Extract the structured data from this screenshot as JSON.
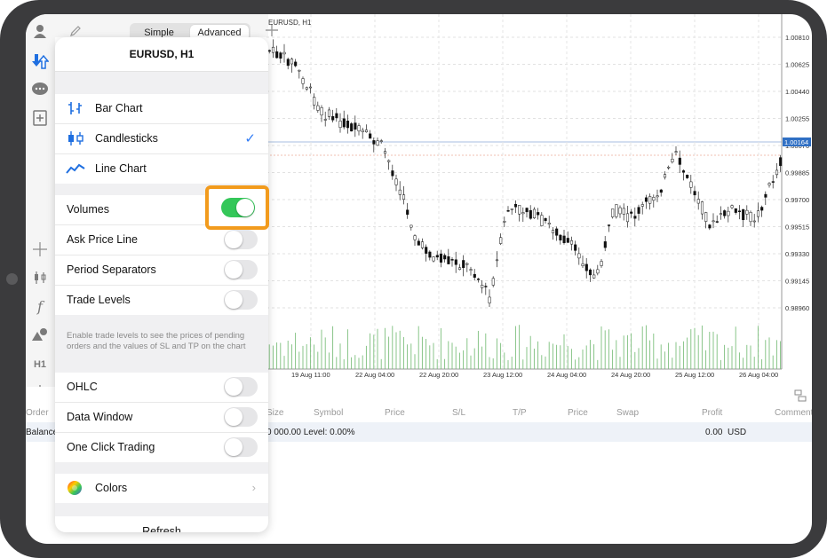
{
  "toolbar": {
    "simple_label": "Simple",
    "advanced_label": "Advanced"
  },
  "chart": {
    "symbol_title": "EURUSD, H1",
    "price_labels": [
      "1.00810",
      "1.00625",
      "1.00440",
      "1.00255",
      "1.00164",
      "1.00070",
      "0.99885",
      "0.99700",
      "0.99515",
      "0.99330",
      "0.99145",
      "0.98960"
    ],
    "current_price": "1.00164",
    "time_labels": [
      "19 Aug 11:00",
      "22 Aug 04:00",
      "22 Aug 20:00",
      "23 Aug 12:00",
      "24 Aug 04:00",
      "24 Aug 20:00",
      "25 Aug 12:00",
      "26 Aug 04:00"
    ],
    "colors": {
      "current_line": "#8aa9d6",
      "volume": "#7cbf7c",
      "highlight": "#f29b1d",
      "toggle_on": "#34c759",
      "accent": "#2f7bf6"
    }
  },
  "popup": {
    "title": "EURUSD, H1",
    "chart_types": [
      {
        "label": "Bar Chart",
        "icon": "bar-chart-icon",
        "selected": false
      },
      {
        "label": "Candlesticks",
        "icon": "candlesticks-icon",
        "selected": true
      },
      {
        "label": "Line Chart",
        "icon": "line-chart-icon",
        "selected": false
      }
    ],
    "options": [
      {
        "label": "Volumes",
        "on": true
      },
      {
        "label": "Ask Price Line",
        "on": false
      },
      {
        "label": "Period Separators",
        "on": false
      },
      {
        "label": "Trade Levels",
        "on": false
      }
    ],
    "note": "Enable trade levels to see the prices of pending orders and the values of SL and TP on the chart",
    "extras": [
      {
        "label": "OHLC",
        "on": false
      },
      {
        "label": "Data Window",
        "on": false
      },
      {
        "label": "One Click Trading",
        "on": false
      }
    ],
    "colors_label": "Colors",
    "refresh_label": "Refresh"
  },
  "table": {
    "headers": [
      "Order",
      "Size",
      "Symbol",
      "Price",
      "S/L",
      "T/P",
      "Price",
      "Swap",
      "Profit",
      "Comment"
    ],
    "balance_label": "Balance",
    "balance_text": "0 000.00 Level: 0.00%",
    "profit_value": "0.00",
    "currency": "USD"
  }
}
